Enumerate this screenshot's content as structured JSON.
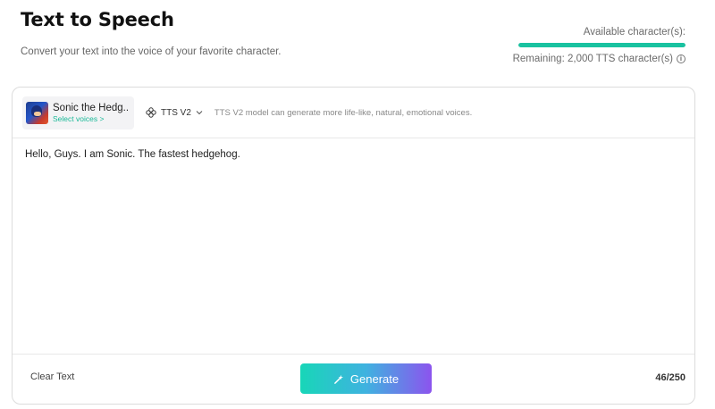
{
  "header": {
    "title": "Text to Speech",
    "subtitle": "Convert your text into the voice of your favorite character."
  },
  "quota": {
    "label": "Available character(s):",
    "remaining": "Remaining: 2,000 TTS character(s)",
    "fill_fraction": 1.0,
    "info_icon": "info-icon",
    "accent": "#19c2a0"
  },
  "voice": {
    "name": "Sonic the Hedg...",
    "select_label": "Select voices >",
    "avatar": "sonic-avatar"
  },
  "model": {
    "label": "TTS V2",
    "icon": "model-icon",
    "description": "TTS V2 model can generate more life-like, natural, emotional voices."
  },
  "editor": {
    "value": "Hello, Guys. I am Sonic. The fastest hedgehog."
  },
  "footer": {
    "clear_label": "Clear Text",
    "generate_label": "Generate",
    "generate_icon": "wand-icon",
    "char_count": "46/250",
    "gradient": [
      "#18d6b8",
      "#3fb2e0",
      "#8c54ee"
    ]
  }
}
